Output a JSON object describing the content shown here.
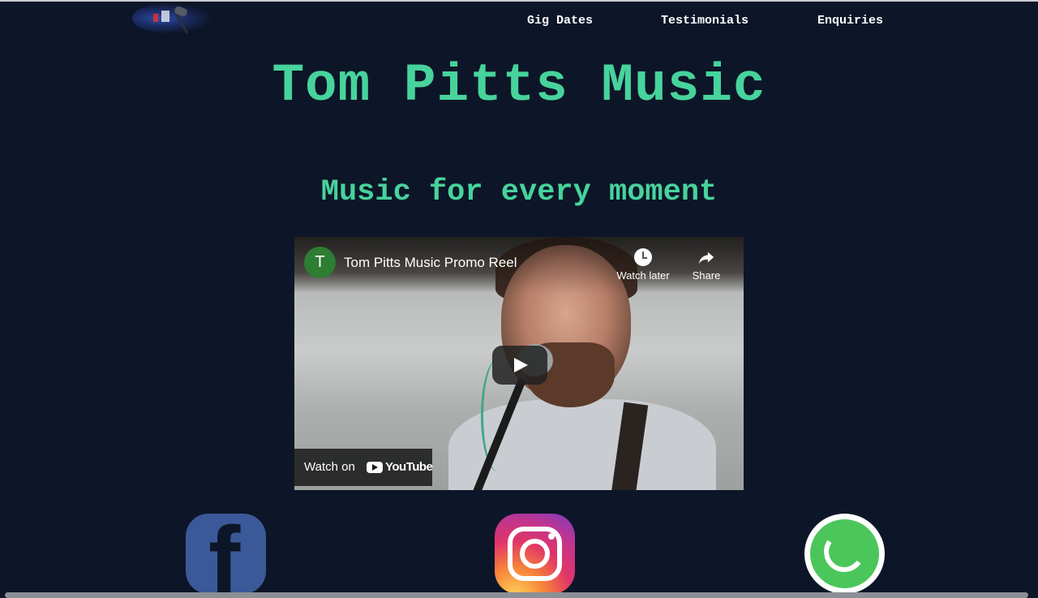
{
  "nav": {
    "items": [
      {
        "label": "Gig Dates"
      },
      {
        "label": "Testimonials"
      },
      {
        "label": "Enquiries"
      }
    ]
  },
  "hero": {
    "title": "Tom Pitts Music",
    "tagline": "Music for every moment"
  },
  "video": {
    "channel_initial": "T",
    "title": "Tom Pitts Music Promo Reel",
    "watch_later_label": "Watch later",
    "share_label": "Share",
    "watch_on_label": "Watch on",
    "brand_label": "YouTube"
  },
  "social": {
    "icons": [
      "facebook-icon",
      "instagram-icon",
      "whatsapp-icon"
    ]
  },
  "colors": {
    "background": "#0d1628",
    "accent": "#47d39c"
  }
}
